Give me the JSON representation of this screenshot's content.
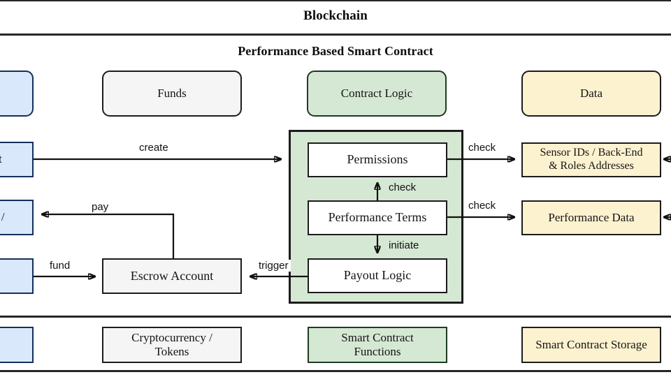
{
  "bands": {
    "blockchain_title": "Blockchain",
    "contract_title": "Performance Based Smart Contract"
  },
  "legend_row": [
    {
      "label": "",
      "color": "#dae8fc",
      "name": "legend-actors"
    },
    {
      "label": "Funds",
      "color": "#f5f5f5",
      "name": "legend-funds"
    },
    {
      "label": "Contract Logic",
      "color": "#d5e8d4",
      "name": "legend-contract-logic"
    },
    {
      "label": "Data",
      "color": "#fdf2d0",
      "name": "legend-data"
    }
  ],
  "left_actors": [
    {
      "label": "t",
      "name": "actor-client"
    },
    {
      "label": "r /",
      "name": "actor-provider"
    },
    {
      "label": "",
      "name": "actor-funder"
    }
  ],
  "escrow": {
    "label": "Escrow Account"
  },
  "contract_logic": {
    "permissions": "Permissions",
    "performance_terms": "Performance Terms",
    "payout_logic": "Payout Logic"
  },
  "data_stores": [
    {
      "label": "Sensor IDs / Back-End\n& Roles Addresses",
      "line1": "Sensor IDs / Back-End",
      "line2": "& Roles Addresses"
    },
    {
      "label": "Performance Data",
      "line1": "Performance Data",
      "line2": ""
    }
  ],
  "edges": [
    {
      "label": "create",
      "name": "edge-create"
    },
    {
      "label": "pay",
      "name": "edge-pay"
    },
    {
      "label": "fund",
      "name": "edge-fund"
    },
    {
      "label": "trigger",
      "name": "edge-trigger"
    },
    {
      "label": "check",
      "name": "edge-check-permissions"
    },
    {
      "label": "check",
      "name": "edge-check-terms"
    },
    {
      "label": "check",
      "name": "edge-check-up"
    },
    {
      "label": "initiate",
      "name": "edge-initiate"
    }
  ],
  "bottom_row": [
    {
      "line1": "",
      "line2": "",
      "name": "bottom-actors"
    },
    {
      "line1": "Cryptocurrency /",
      "line2": "Tokens",
      "name": "bottom-crypto"
    },
    {
      "line1": "Smart Contract",
      "line2": "Functions",
      "name": "bottom-functions"
    },
    {
      "line1": "Smart Contract Storage",
      "line2": "",
      "name": "bottom-storage"
    }
  ],
  "colors": {
    "blue": "#dae8fc",
    "gray": "#f5f5f5",
    "green": "#d5e8d4",
    "cream": "#fdf2d0",
    "stroke": "#1c1c1c"
  }
}
